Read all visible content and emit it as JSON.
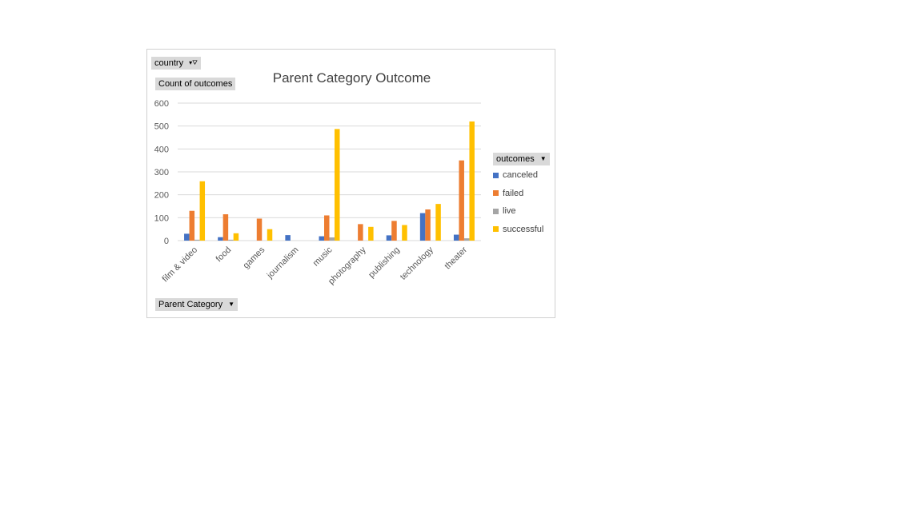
{
  "filters": {
    "country_label": "country",
    "value_field_label": "Count of outcomes",
    "legend_field_label": "outcomes",
    "axis_field_label": "Parent Category"
  },
  "colors": {
    "canceled": "#4472c4",
    "failed": "#ed7d31",
    "live": "#a5a5a5",
    "successful": "#ffc000"
  },
  "chart_data": {
    "type": "bar",
    "title": "Parent Category Outcome",
    "xlabel": "",
    "ylabel": "",
    "ylim": [
      0,
      600
    ],
    "yticks": [
      0,
      100,
      200,
      300,
      400,
      500,
      600
    ],
    "grid": true,
    "legend_position": "right",
    "categories": [
      "film & video",
      "food",
      "games",
      "journalism",
      "music",
      "photography",
      "publishing",
      "technology",
      "theater"
    ],
    "series": [
      {
        "name": "canceled",
        "values": [
          30,
          15,
          0,
          24,
          19,
          0,
          23,
          120,
          26
        ]
      },
      {
        "name": "failed",
        "values": [
          130,
          115,
          96,
          0,
          110,
          72,
          86,
          136,
          350
        ]
      },
      {
        "name": "live",
        "values": [
          4,
          4,
          0,
          0,
          14,
          0,
          0,
          0,
          10
        ]
      },
      {
        "name": "successful",
        "values": [
          259,
          32,
          50,
          0,
          487,
          60,
          68,
          160,
          520
        ]
      }
    ]
  }
}
